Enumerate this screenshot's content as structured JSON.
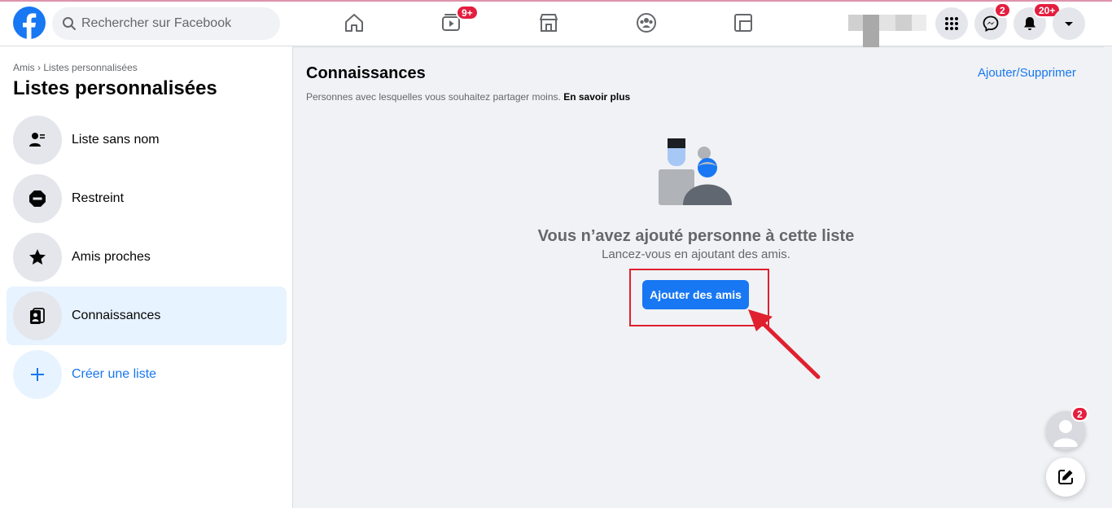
{
  "topbar": {
    "search_placeholder": "Rechercher sur Facebook",
    "badges": {
      "watch": "9+",
      "messenger": "2",
      "notifications": "20+"
    }
  },
  "nav_icons": [
    "home-icon",
    "watch-icon",
    "marketplace-icon",
    "groups-icon",
    "gaming-icon"
  ],
  "sidebar": {
    "breadcrumb_root": "Amis",
    "breadcrumb_sep": "›",
    "breadcrumb_current": "Listes personnalisées",
    "title": "Listes personnalisées",
    "items": [
      {
        "label": "Liste sans nom",
        "icon": "person-list-icon"
      },
      {
        "label": "Restreint",
        "icon": "restricted-icon"
      },
      {
        "label": "Amis proches",
        "icon": "star-icon"
      },
      {
        "label": "Connaissances",
        "icon": "acquaintances-icon"
      },
      {
        "label": "Créer une liste",
        "icon": "plus-icon"
      }
    ],
    "active_index": 3
  },
  "main": {
    "title": "Connaissances",
    "add_remove_link": "Ajouter/Supprimer",
    "subtitle": "Personnes avec lesquelles vous souhaitez partager moins.",
    "learn_more": "En savoir plus",
    "empty_title": "Vous n’avez ajouté personne à cette liste",
    "empty_subtitle": "Lancez-vous en ajoutant des amis.",
    "add_button": "Ajouter des amis"
  },
  "chat": {
    "badge": "2"
  },
  "colors": {
    "brand": "#1877f2",
    "badge": "#e41e3f",
    "highlight": "#e0202e"
  }
}
